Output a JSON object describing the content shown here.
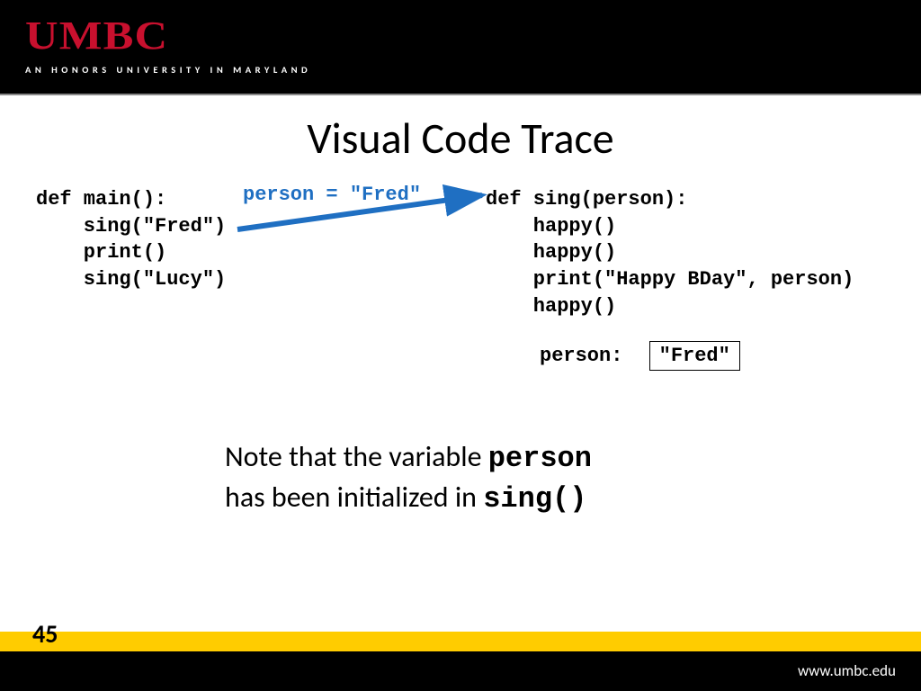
{
  "header": {
    "logo": "UMBC",
    "tagline": "AN HONORS UNIVERSITY IN MARYLAND"
  },
  "slide": {
    "title": "Visual Code Trace",
    "left_code": "def main():\n    sing(\"Fred\")\n    print()\n    sing(\"Lucy\")",
    "right_code": "def sing(person):\n    happy()\n    happy()\n    print(\"Happy BDay\", person)\n    happy()",
    "annotation": "person = \"Fred\"",
    "var_label": "person:",
    "var_value": "\"Fred\"",
    "note_pre": "Note that the variable ",
    "note_var": "person",
    "note_mid": "has been initialized in ",
    "note_fn": "sing()"
  },
  "footer": {
    "page": "45",
    "url": "www.umbc.edu"
  }
}
